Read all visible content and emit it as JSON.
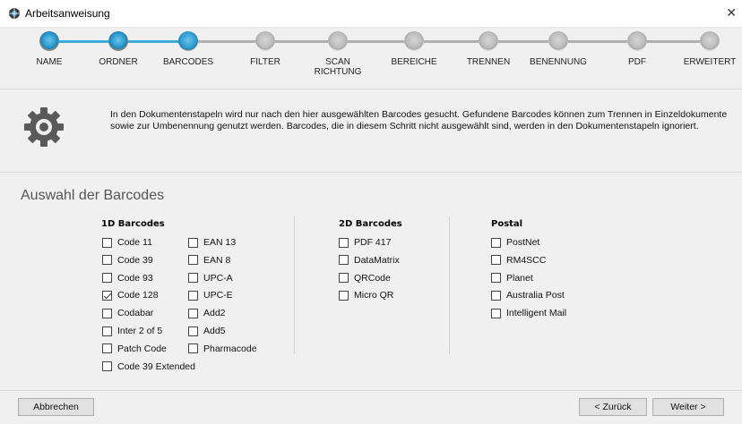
{
  "window": {
    "title": "Arbeitsanweisung",
    "close_glyph": "✕"
  },
  "wizard": {
    "steps": [
      {
        "label": "NAME",
        "state": "done"
      },
      {
        "label": "ORDNER",
        "state": "done"
      },
      {
        "label": "BARCODES",
        "state": "current"
      },
      {
        "label": "FILTER",
        "state": "todo"
      },
      {
        "label": "SCAN\nRICHTUNG",
        "state": "todo"
      },
      {
        "label": "BEREICHE",
        "state": "todo"
      },
      {
        "label": "TRENNEN",
        "state": "todo"
      },
      {
        "label": "BENENNUNG",
        "state": "todo"
      },
      {
        "label": "PDF",
        "state": "todo"
      },
      {
        "label": "ERWEITERT",
        "state": "todo"
      }
    ],
    "colors": {
      "done_line": "#3fa9d8",
      "todo_line": "#b0b0b0"
    }
  },
  "info": {
    "icon": "gear-icon",
    "text": "In den Dokumentenstapeln wird nur nach den hier ausgewählten Barcodes gesucht. Gefundene Barcodes können zum Trennen in Einzeldokumente sowie zur Umbenennung genutzt werden. Barcodes, die in diesem Schritt nicht ausgewählt sind, werden in den Dokumentenstapeln ignoriert."
  },
  "section": {
    "title": "Auswahl der Barcodes"
  },
  "barcodes_1d": {
    "heading": "1D Barcodes",
    "col1": [
      {
        "label": "Code 11",
        "checked": false
      },
      {
        "label": "Code 39",
        "checked": false
      },
      {
        "label": "Code 93",
        "checked": false
      },
      {
        "label": "Code 128",
        "checked": true
      },
      {
        "label": "Codabar",
        "checked": false
      },
      {
        "label": "Inter 2 of 5",
        "checked": false
      },
      {
        "label": "Patch Code",
        "checked": false
      },
      {
        "label": "Code 39 Extended",
        "checked": false
      }
    ],
    "col2": [
      {
        "label": "EAN 13",
        "checked": false
      },
      {
        "label": "EAN 8",
        "checked": false
      },
      {
        "label": "UPC-A",
        "checked": false
      },
      {
        "label": "UPC-E",
        "checked": false
      },
      {
        "label": "Add2",
        "checked": false
      },
      {
        "label": "Add5",
        "checked": false
      },
      {
        "label": "Pharmacode",
        "checked": false
      }
    ]
  },
  "barcodes_2d": {
    "heading": "2D Barcodes",
    "items": [
      {
        "label": "PDF 417",
        "checked": false
      },
      {
        "label": "DataMatrix",
        "checked": false
      },
      {
        "label": "QRCode",
        "checked": false
      },
      {
        "label": "Micro QR",
        "checked": false
      }
    ]
  },
  "postal": {
    "heading": "Postal",
    "items": [
      {
        "label": "PostNet",
        "checked": false
      },
      {
        "label": "RM4SCC",
        "checked": false
      },
      {
        "label": "Planet",
        "checked": false
      },
      {
        "label": "Australia Post",
        "checked": false
      },
      {
        "label": "Intelligent Mail",
        "checked": false
      }
    ]
  },
  "footer": {
    "cancel_label": "Abbrechen",
    "back_label": "< Zurück",
    "next_label": "Weiter >"
  }
}
